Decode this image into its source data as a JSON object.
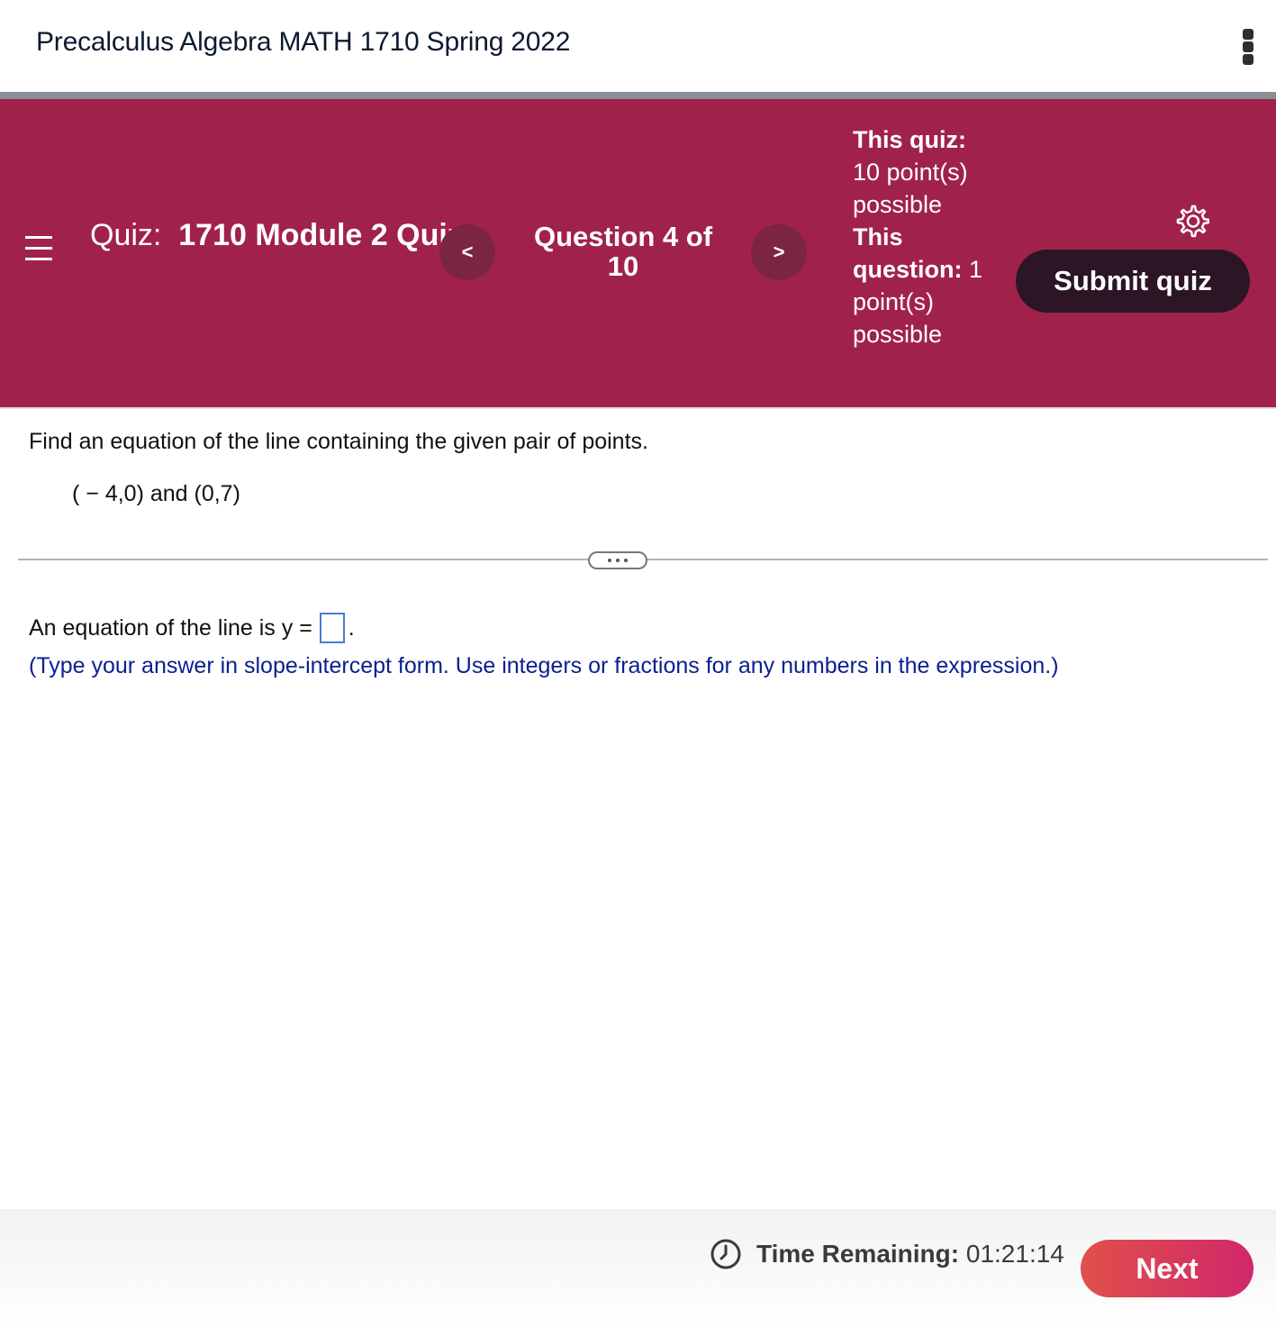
{
  "course": {
    "title": "Precalculus Algebra MATH 1710 Spring 2022"
  },
  "header": {
    "quiz_prefix": "Quiz:",
    "quiz_name": "1710 Module 2 Quiz",
    "prev_label": "<",
    "next_label": ">",
    "question_counter": "Question 4 of 10",
    "quiz_points_label": "This quiz:",
    "quiz_points_value": "10 point(s) possible",
    "question_points_label": "This question:",
    "question_points_value": "1 point(s) possible",
    "submit_label": "Submit quiz"
  },
  "question": {
    "prompt": "Find an equation of the line containing the given pair of points.",
    "given_points": "( − 4,0) and (0,7)",
    "answer_prefix": "An equation of the line is y =",
    "answer_value": "",
    "answer_suffix": ".",
    "instruction": "(Type your answer in slope-intercept form. Use integers or fractions for any numbers in the expression.)"
  },
  "footer": {
    "time_label": "Time Remaining:",
    "time_value": "01:21:14",
    "next_label": "Next"
  },
  "colors": {
    "header_bg": "#a0224a",
    "submit_bg": "#2c1626",
    "instruction_text": "#0a1f8f",
    "next_gradient_start": "#e0504a",
    "next_gradient_end": "#d0286a"
  },
  "icons": [
    "kebab-menu-icon",
    "hamburger-menu-icon",
    "chevron-left-icon",
    "chevron-right-icon",
    "gear-icon",
    "clock-icon"
  ]
}
